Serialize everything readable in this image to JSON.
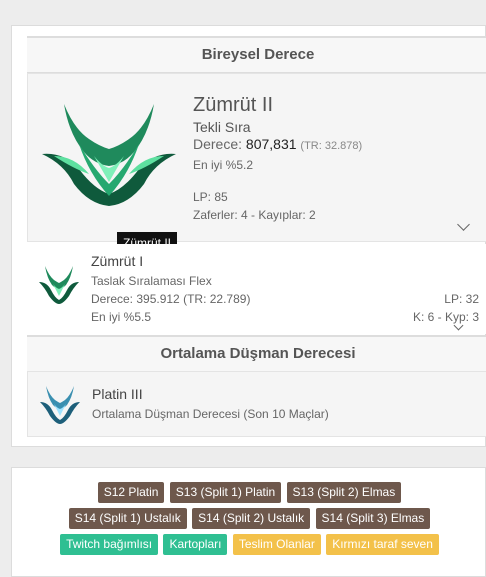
{
  "ranked": {
    "title": "Bireysel Derece",
    "solo": {
      "tier": "Zümrüt II",
      "queue": "Tekli Sıra",
      "rank_label": "Derece:",
      "rank": "807,831",
      "tr_rank": "(TR: 32.878)",
      "top": "En iyi %5.2",
      "lp": "LP: 85",
      "record": "Zaferler: 4 - Kayıplar: 2",
      "tooltip": "Zümrüt II"
    },
    "flex": {
      "tier": "Zümrüt I",
      "queue": "Taslak Sıralaması Flex",
      "rank": "Derece: 395.912",
      "tr_rank": "(TR: 22.789)",
      "top": "En iyi %5.5",
      "lp": "LP: 32",
      "record": "K: 6 - Kyp: 3"
    }
  },
  "enemy": {
    "title": "Ortalama Düşman Derecesi",
    "tier": "Platin III",
    "desc": "Ortalama Düşman Derecesi (Son 10 Maçlar)"
  },
  "tags": {
    "row1": [
      "S12 Platin",
      "S13 (Split 1) Platin",
      "S13 (Split 2) Elmas"
    ],
    "row2": [
      "S14 (Split 1) Ustalık",
      "S14 (Split 2) Ustalık",
      "S14 (Split 3) Elmas"
    ],
    "row3_teal": [
      "Twitch bağımlısı",
      "Kartopları"
    ],
    "row3_yellow": [
      "Teslim Olanlar",
      "Kırmızı taraf seven"
    ]
  },
  "colors": {
    "brown": "#6e584c",
    "teal": "#2fbf92",
    "yellow": "#f3c14a",
    "emerald": "#1f8a5c",
    "platinum": "#3a8fb0"
  }
}
